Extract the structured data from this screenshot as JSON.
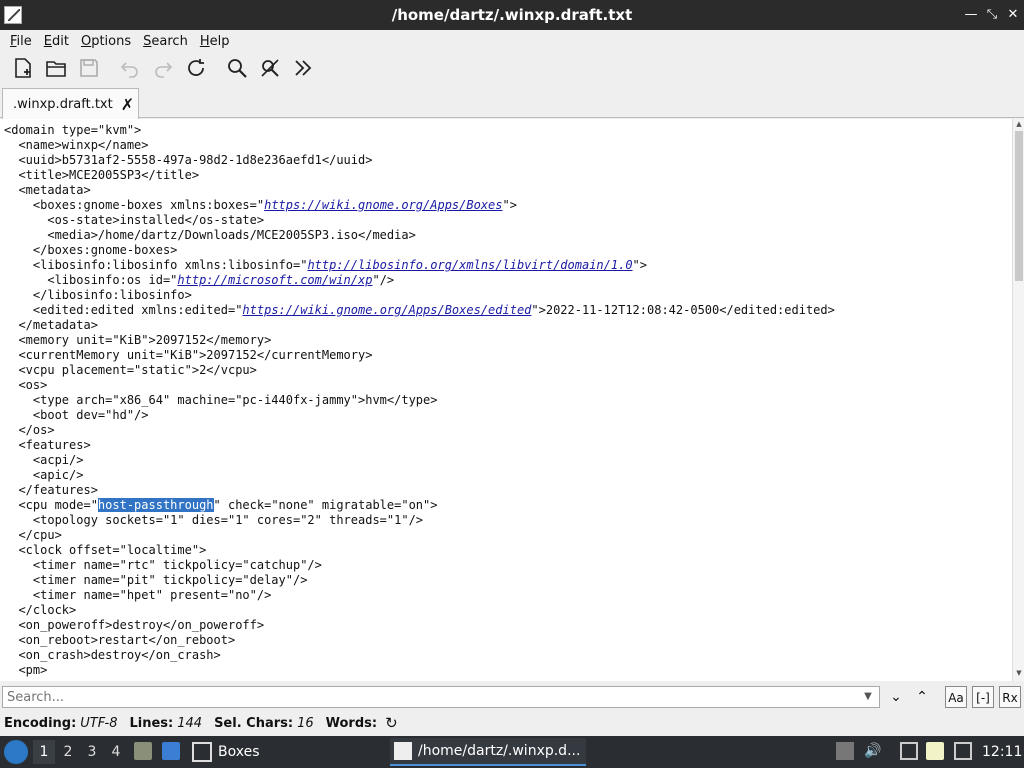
{
  "window": {
    "title": "/home/dartz/.winxp.draft.txt"
  },
  "menu": {
    "file": "File",
    "edit": "Edit",
    "options": "Options",
    "search": "Search",
    "help": "Help"
  },
  "toolbar": {
    "icons": [
      "new-file-icon",
      "open-folder-icon",
      "save-icon",
      "undo-icon",
      "redo-icon",
      "reload-icon",
      "find-icon",
      "find-replace-icon",
      "more-icon"
    ]
  },
  "tab": {
    "label": ".winxp.draft.txt"
  },
  "editor": {
    "lines": [
      "<domain type=\"kvm\">",
      "  <name>winxp</name>",
      "  <uuid>b5731af2-5558-497a-98d2-1d8e236aefd1</uuid>",
      "  <title>MCE2005SP3</title>",
      "  <metadata>",
      "    <boxes:gnome-boxes xmlns:boxes=\"",
      "      <os-state>installed</os-state>",
      "      <media>/home/dartz/Downloads/MCE2005SP3.iso</media>",
      "    </boxes:gnome-boxes>",
      "    <libosinfo:libosinfo xmlns:libosinfo=\"",
      "      <libosinfo:os id=\"",
      "    </libosinfo:libosinfo>",
      "    <edited:edited xmlns:edited=\"",
      "  </metadata>",
      "  <memory unit=\"KiB\">2097152</memory>",
      "  <currentMemory unit=\"KiB\">2097152</currentMemory>",
      "  <vcpu placement=\"static\">2</vcpu>",
      "  <os>",
      "    <type arch=\"x86_64\" machine=\"pc-i440fx-jammy\">hvm</type>",
      "    <boot dev=\"hd\"/>",
      "  </os>",
      "  <features>",
      "    <acpi/>",
      "    <apic/>",
      "  </features>",
      "  <cpu mode=\"",
      "    <topology sockets=\"1\" dies=\"1\" cores=\"2\" threads=\"1\"/>",
      "  </cpu>",
      "  <clock offset=\"localtime\">",
      "    <timer name=\"rtc\" tickpolicy=\"catchup\"/>",
      "    <timer name=\"pit\" tickpolicy=\"delay\"/>",
      "    <timer name=\"hpet\" present=\"no\"/>",
      "  </clock>",
      "  <on_poweroff>destroy</on_poweroff>",
      "  <on_reboot>restart</on_reboot>",
      "  <on_crash>destroy</on_crash>",
      "  <pm>"
    ],
    "link1": "https://wiki.gnome.org/Apps/Boxes",
    "link1_tail": "\">",
    "link2": "http://libosinfo.org/xmlns/libvirt/domain/1.0",
    "link2_tail": "\">",
    "link3": "http://microsoft.com/win/xp",
    "link3_tail": "\"/>",
    "link4": "https://wiki.gnome.org/Apps/Boxes/edited",
    "link4_tail": "\">2022-11-12T12:08:42-0500</edited:edited>",
    "selected": "host-passthrough",
    "cpu_tail": "\" check=\"none\" migratable=\"on\">"
  },
  "search": {
    "placeholder": "Search...",
    "match_case": "Aa",
    "whole_word": "[-]",
    "regex": "Rx"
  },
  "status": {
    "encoding_label": "Encoding:",
    "encoding_value": "UTF-8",
    "lines_label": "Lines:",
    "lines_value": "144",
    "sel_label": "Sel. Chars:",
    "sel_value": "16",
    "words_label": "Words:"
  },
  "taskbar": {
    "workspaces": [
      "1",
      "2",
      "3",
      "4"
    ],
    "boxes_label": "Boxes",
    "editor_label": "/home/dartz/.winxp.d...",
    "clock": "12:11"
  }
}
